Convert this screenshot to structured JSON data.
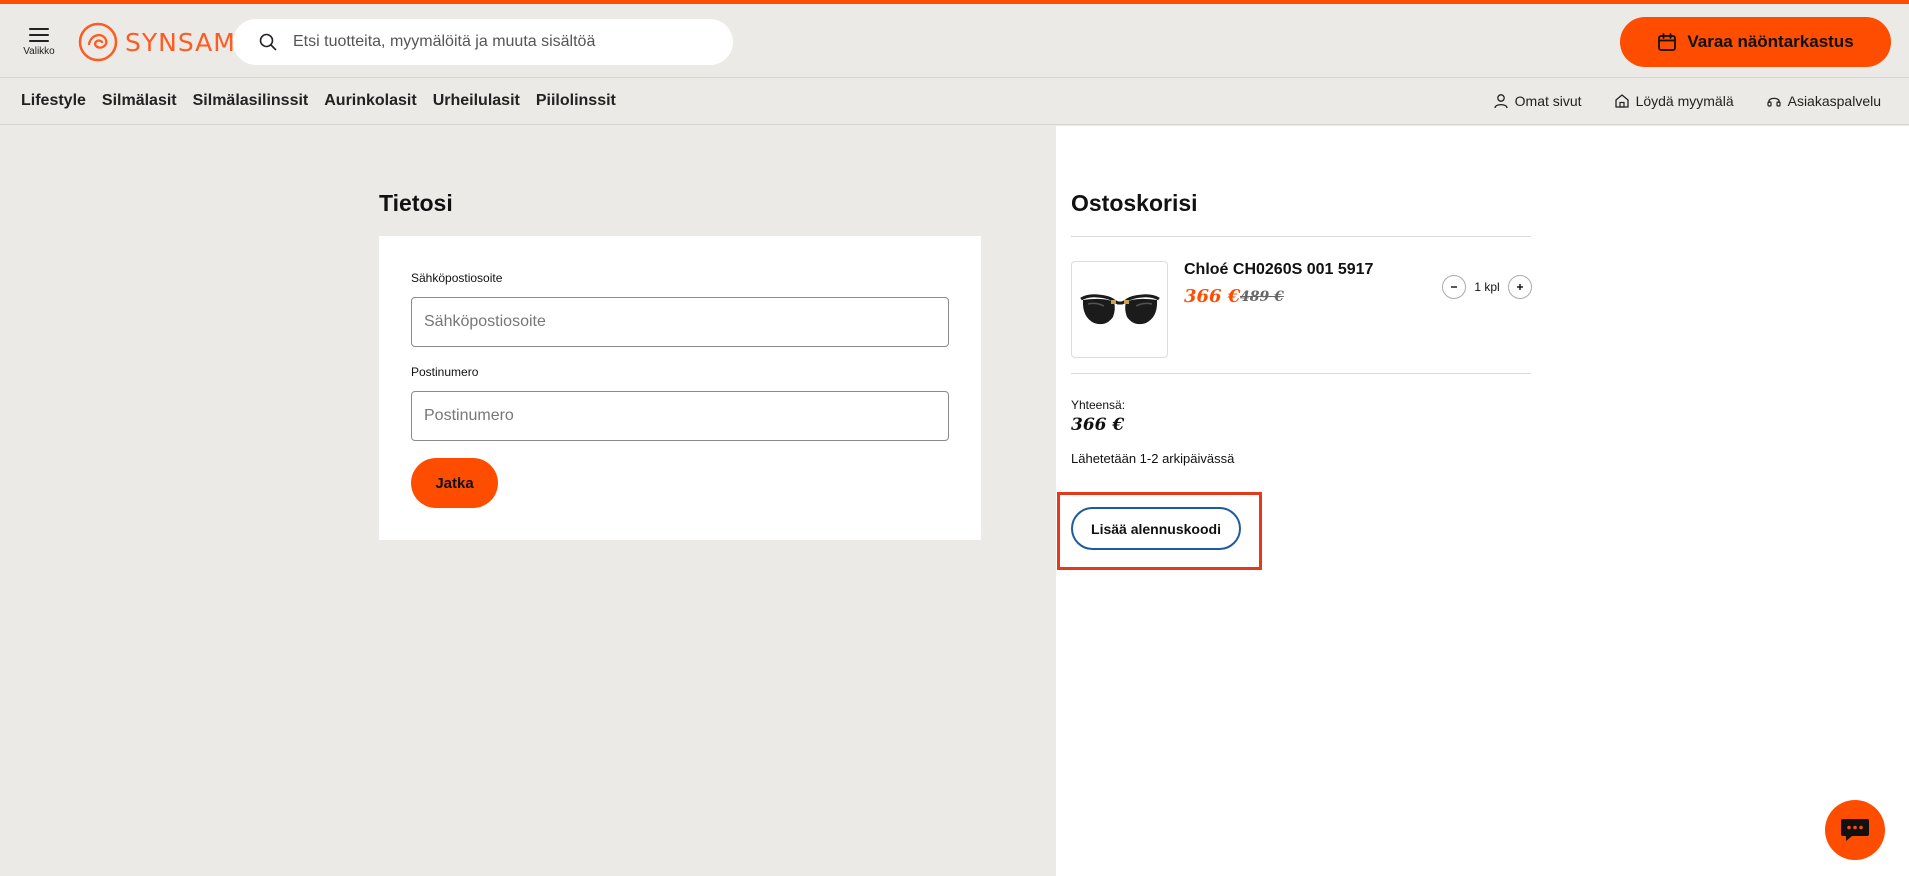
{
  "header": {
    "menu_label": "Valikko",
    "logo_text": "SYNSAM",
    "search_placeholder": "Etsi tuotteita, myymälöitä ja muuta sisältöä",
    "cta_label": "Varaa näöntarkastus"
  },
  "nav": {
    "main": [
      "Lifestyle",
      "Silmälasit",
      "Silmälasilinssit",
      "Aurinkolasit",
      "Urheilulasit",
      "Piilolinssit"
    ],
    "util": [
      {
        "label": "Omat sivut",
        "icon": "user-icon"
      },
      {
        "label": "Löydä myymälä",
        "icon": "store-icon"
      },
      {
        "label": "Asiakaspalvelu",
        "icon": "headset-icon"
      }
    ]
  },
  "form": {
    "title": "Tietosi",
    "email_label": "Sähköpostiosoite",
    "email_placeholder": "Sähköpostiosoite",
    "email_value": "",
    "postal_label": "Postinumero",
    "postal_placeholder": "Postinumero",
    "postal_value": "",
    "submit_label": "Jatka"
  },
  "cart": {
    "title": "Ostoskorisi",
    "item": {
      "name": "Chloé CH0260S 001 5917",
      "price": "366 €",
      "old_price": "489 €",
      "quantity": "1 kpl",
      "image": "sunglasses"
    },
    "total_label": "Yhteensä:",
    "total_value": "366 €",
    "shipping": "Lähetetään 1-2 arkipäivässä",
    "discount_label": "Lisää alennuskoodi"
  },
  "colors": {
    "accent": "#ff4d00",
    "background": "#eceae6",
    "highlight": "#e5391c",
    "discount_border": "#1f5c9f"
  }
}
